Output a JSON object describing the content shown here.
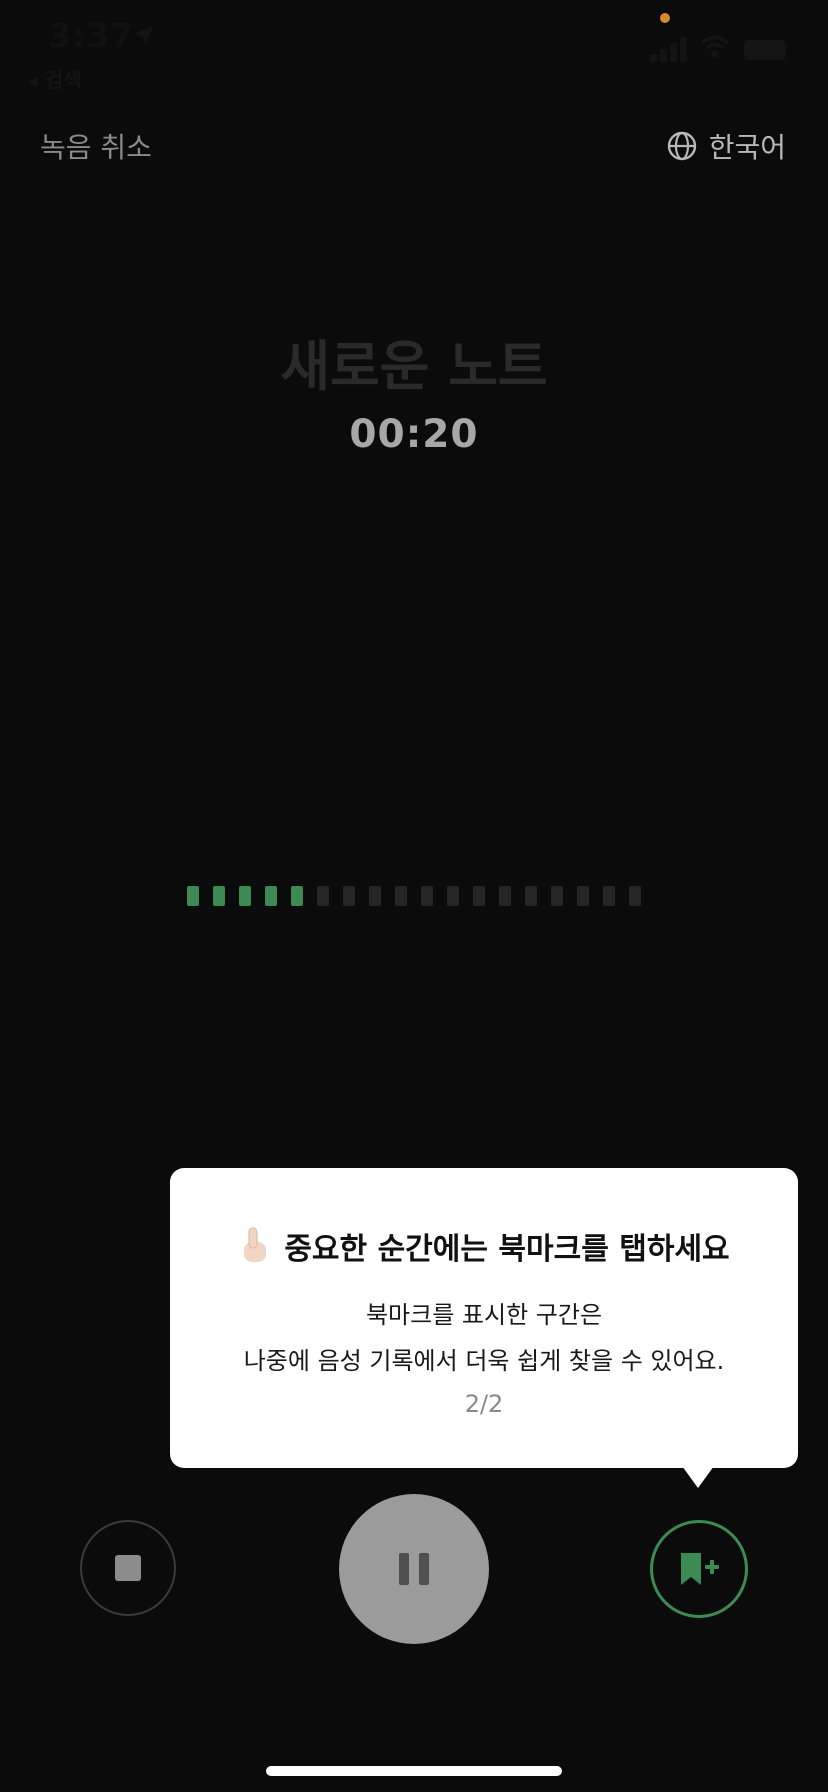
{
  "status_bar": {
    "time": "3:37",
    "back_app": "◂ 검색"
  },
  "top_bar": {
    "cancel_label": "녹음 취소",
    "language_label": "한국어",
    "language_icon": "globe-icon"
  },
  "note": {
    "title": "새로운 노트",
    "elapsed": "00:20"
  },
  "level_meter": {
    "bars_total": 18,
    "bars_active": 5,
    "active_color": "#3e8a55",
    "inactive_color": "#262626"
  },
  "tooltip": {
    "emoji": "👆🏻",
    "title": "중요한 순간에는 북마크를 탭하세요",
    "body_line1": "북마크를 표시한 구간은",
    "body_line2": "나중에 음성 기록에서 더욱 쉽게 찾을 수 있어요.",
    "page_indicator": "2/2"
  },
  "controls": {
    "stop_icon": "stop-icon",
    "pause_icon": "pause-icon",
    "bookmark_icon": "bookmark-add-icon",
    "accent_color": "#3e8a55"
  }
}
